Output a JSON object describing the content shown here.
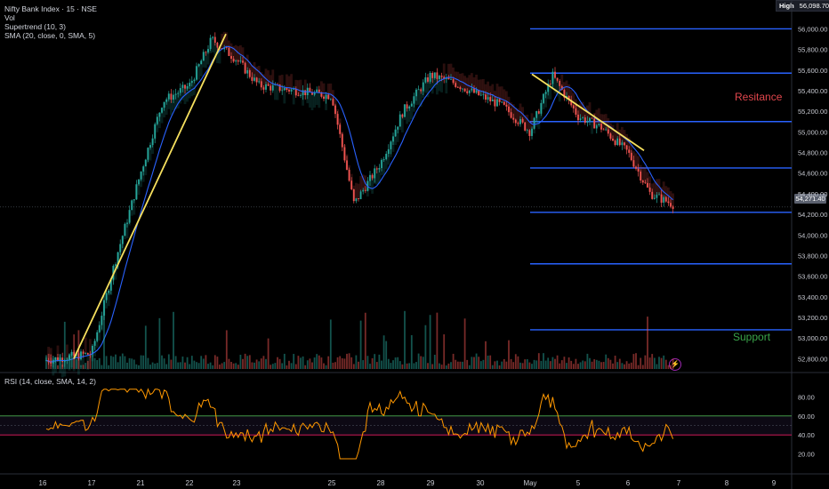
{
  "legend": {
    "symbol": "Nifty Bank Index · 15 · NSE",
    "vol": "Vol",
    "supertrend": "Supertrend (10, 3)",
    "sma": "SMA (20, close, 0, SMA, 5)",
    "rsi": "RSI (14, close, SMA, 14, 2)"
  },
  "high_label": "High",
  "high_value": "56,098.70",
  "last_price": "54,271.40",
  "annotations": {
    "resistance": "Resitance",
    "support": "Support"
  },
  "colors": {
    "up": "#26a69a",
    "down": "#ef5350",
    "sma": "#2962ff",
    "trend": "#f6e05e",
    "level": "#2962ff",
    "rsi": "#ff9800",
    "resistance_text": "#e0464c",
    "support_text": "#3aa54a"
  },
  "chart_data": {
    "type": "candlestick",
    "x_ticks": [
      "16",
      "17",
      "21",
      "22",
      "23",
      "25",
      "28",
      "29",
      "30",
      "May",
      "5",
      "6",
      "7",
      "8",
      "9"
    ],
    "y_ticks": [
      "56,000.00",
      "55,800.00",
      "55,600.00",
      "55,400.00",
      "55,200.00",
      "55,000.00",
      "54,800.00",
      "54,600.00",
      "54,400.00",
      "54,200.00",
      "54,000.00",
      "53,800.00",
      "53,600.00",
      "53,400.00",
      "53,200.00",
      "53,000.00",
      "52,800.00"
    ],
    "ylim": [
      52700,
      56150
    ],
    "horizontal_levels": [
      56000,
      55570,
      55100,
      54650,
      54220,
      53720,
      53080
    ],
    "trend_lines": [
      {
        "name": "up",
        "from": {
          "x": "16",
          "y": 52800
        },
        "to": {
          "x": "22",
          "y": 55950
        }
      },
      {
        "name": "down",
        "from": {
          "x": "May",
          "y": 55560
        },
        "to": {
          "x": "6",
          "y": 54820
        }
      }
    ],
    "close_path": [
      [
        "16",
        52780
      ],
      [
        "17",
        52850
      ],
      [
        "17",
        53700
      ],
      [
        "21",
        54600
      ],
      [
        "21",
        55300
      ],
      [
        "22",
        55450
      ],
      [
        "22",
        55900
      ],
      [
        "23",
        55700
      ],
      [
        "23",
        55450
      ],
      [
        "25",
        55350
      ],
      [
        "25",
        54300
      ],
      [
        "28",
        54700
      ],
      [
        "28",
        55200
      ],
      [
        "29",
        55550
      ],
      [
        "29",
        55480
      ],
      [
        "30",
        55350
      ],
      [
        "30",
        55250
      ],
      [
        "May",
        55000
      ],
      [
        "May",
        55550
      ],
      [
        "5",
        55150
      ],
      [
        "5",
        55050
      ],
      [
        "6",
        54800
      ],
      [
        "6",
        54400
      ],
      [
        "7",
        54271
      ]
    ],
    "rsi": {
      "ylim": [
        0,
        100
      ],
      "y_ticks": [
        "80.00",
        "60.00",
        "40.00",
        "20.00"
      ],
      "bands": [
        60,
        40
      ]
    }
  }
}
